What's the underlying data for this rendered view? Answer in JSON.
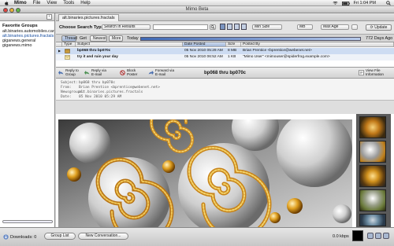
{
  "menubar": {
    "app": "Mimo",
    "items": [
      "File",
      "View",
      "Tools",
      "Help"
    ],
    "time": "Fri 1:04 PM"
  },
  "window": {
    "title": "Mimo Beta"
  },
  "sidebar": {
    "heading": "Favorite Groups",
    "groups": [
      "alt.binaries.automobiles.cars",
      "alt.binaries.pictures.fractals",
      "giganews.general",
      "giganews.mimo"
    ]
  },
  "tabs": [
    "alt.binaries.pictures.fractals"
  ],
  "search": {
    "label": "Choose Search Type:",
    "type": "Search In Results",
    "min_size": "Min Size",
    "size_unit": "MB",
    "max_age": "Max Age",
    "update": "Update"
  },
  "view": {
    "buttons": [
      "Thread",
      "Get",
      "Newest",
      "More"
    ],
    "today": "Today",
    "days_ago": "772 Days Ago"
  },
  "table": {
    "columns": [
      "Type",
      "Subject",
      "Date Posted",
      "Size",
      "Posted By"
    ],
    "rows": [
      {
        "subject": "bp068 thru bp070c",
        "date": "05 Nov 2010 05:29 AM",
        "size": "8 MB",
        "poster": "Brian Prentice <bprentice@webenet.net>"
      },
      {
        "subject": "try it and ruin your day",
        "date": "05 Nov 2010 06:52 AM",
        "size": "1 KB",
        "poster": "\"Mimo User\" <mimouser@spiderfrog.example.com>"
      }
    ]
  },
  "actions": {
    "reply_group": "Reply to\nGroup",
    "reply_email": "Reply via\nE-mail",
    "block": "Block\nPoster",
    "forward": "Forward via\nE-mail",
    "view_file": "View File\nInformation",
    "subject": "bp068 thru bp070c"
  },
  "message": {
    "subject_key": "Subject:",
    "subject": "bp068 thru bp070c",
    "from_key": "From:",
    "from": "Brian Prentice <bprentice@webenet.net>",
    "newsgroups_key": "Newsgroups:",
    "newsgroups": "alt.binaries.pictures.fractals",
    "date_key": "Date:",
    "date": "05 Nov 2010 05:29 AM"
  },
  "statusbar": {
    "downloads": "Downloads: 0",
    "group_list": "Group List",
    "new_conversation": "New Conversation...",
    "speed": "0.0 kbps"
  },
  "colors": {
    "accent": "#1a4fa0",
    "selected_row": "#cddcf2",
    "gold": "#d89a1c"
  }
}
